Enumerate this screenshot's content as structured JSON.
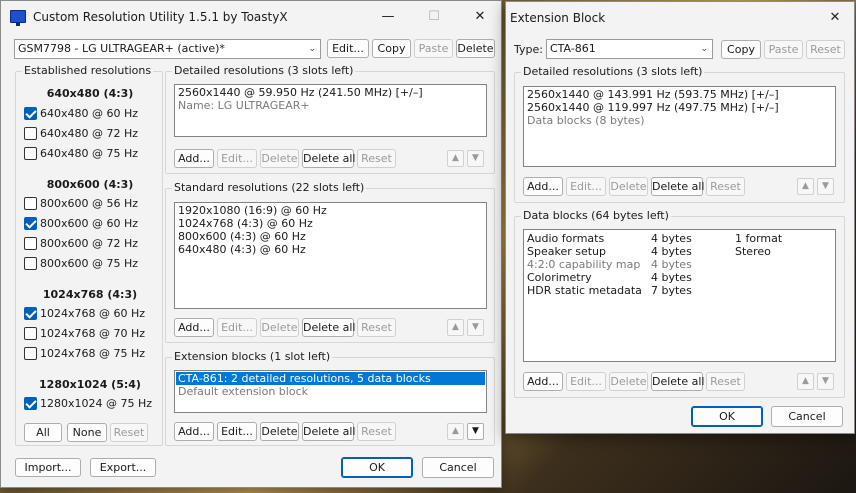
{
  "main_window": {
    "title": "Custom Resolution Utility 1.5.1 by ToastyX",
    "minimize_glyph": "—",
    "maximize_glyph": "☐",
    "close_glyph": "✕",
    "app_icon": "monitor-icon",
    "monitor_select": {
      "value": "GSM7798 - LG ULTRAGEAR+ (active)*"
    },
    "top_buttons": {
      "edit": "Edit...",
      "copy": "Copy",
      "paste": "Paste",
      "delete": "Delete"
    },
    "established": {
      "label": "Established resolutions",
      "groups": [
        {
          "header": "640x480 (4:3)",
          "items": [
            {
              "label": "640x480 @ 60 Hz",
              "checked": true
            },
            {
              "label": "640x480 @ 72 Hz",
              "checked": false
            },
            {
              "label": "640x480 @ 75 Hz",
              "checked": false
            }
          ]
        },
        {
          "header": "800x600 (4:3)",
          "items": [
            {
              "label": "800x600 @ 56 Hz",
              "checked": false
            },
            {
              "label": "800x600 @ 60 Hz",
              "checked": true
            },
            {
              "label": "800x600 @ 72 Hz",
              "checked": false
            },
            {
              "label": "800x600 @ 75 Hz",
              "checked": false
            }
          ]
        },
        {
          "header": "1024x768 (4:3)",
          "items": [
            {
              "label": "1024x768 @ 60 Hz",
              "checked": true
            },
            {
              "label": "1024x768 @ 70 Hz",
              "checked": false
            },
            {
              "label": "1024x768 @ 75 Hz",
              "checked": false
            }
          ]
        },
        {
          "header": "1280x1024 (5:4)",
          "items": [
            {
              "label": "1280x1024 @ 75 Hz",
              "checked": true
            }
          ]
        }
      ],
      "buttons": {
        "all": "All",
        "none": "None",
        "reset": "Reset"
      }
    },
    "detailed": {
      "label": "Detailed resolutions (3 slots left)",
      "rows": [
        "2560x1440 @ 59.950 Hz (241.50 MHz) [+/–]",
        "Name: LG ULTRAGEAR+"
      ],
      "buttons": {
        "add": "Add...",
        "edit": "Edit...",
        "delete": "Delete",
        "delete_all": "Delete all",
        "reset": "Reset"
      }
    },
    "standard": {
      "label": "Standard resolutions (22 slots left)",
      "rows": [
        "1920x1080 (16:9) @ 60 Hz",
        "1024x768 (4:3) @ 60 Hz",
        "800x600 (4:3) @ 60 Hz",
        "640x480 (4:3) @ 60 Hz"
      ],
      "buttons": {
        "add": "Add...",
        "edit": "Edit...",
        "delete": "Delete",
        "delete_all": "Delete all",
        "reset": "Reset"
      }
    },
    "extension": {
      "label": "Extension blocks (1 slot left)",
      "rows": [
        "CTA-861: 2 detailed resolutions, 5 data blocks",
        "Default extension block"
      ],
      "buttons": {
        "add": "Add...",
        "edit": "Edit...",
        "delete": "Delete",
        "delete_all": "Delete all",
        "reset": "Reset"
      }
    },
    "bottom": {
      "import": "Import...",
      "export": "Export...",
      "ok": "OK",
      "cancel": "Cancel"
    },
    "arrows": {
      "up": "▲",
      "down": "▼"
    }
  },
  "ext_window": {
    "title": "Extension Block",
    "close_glyph": "✕",
    "type_label": "Type:",
    "type_value": "CTA-861",
    "top_buttons": {
      "copy": "Copy",
      "paste": "Paste",
      "reset": "Reset"
    },
    "detailed": {
      "label": "Detailed resolutions (3 slots left)",
      "rows": [
        "2560x1440 @ 143.991 Hz (593.75 MHz) [+/–]",
        "2560x1440 @ 119.997 Hz (497.75 MHz) [+/–]",
        "Data blocks (8 bytes)"
      ],
      "buttons": {
        "add": "Add...",
        "edit": "Edit...",
        "delete": "Delete",
        "delete_all": "Delete all",
        "reset": "Reset"
      }
    },
    "data_blocks": {
      "label": "Data blocks (64 bytes left)",
      "rows": [
        {
          "name": "Audio formats",
          "size": "4 bytes",
          "info": "1 format"
        },
        {
          "name": "Speaker setup",
          "size": "4 bytes",
          "info": "Stereo"
        },
        {
          "name": "4:2:0 capability map",
          "size": "4 bytes",
          "info": ""
        },
        {
          "name": "Colorimetry",
          "size": "4 bytes",
          "info": ""
        },
        {
          "name": "HDR static metadata",
          "size": "7 bytes",
          "info": ""
        }
      ],
      "buttons": {
        "add": "Add...",
        "edit": "Edit...",
        "delete": "Delete",
        "delete_all": "Delete all",
        "reset": "Reset"
      }
    },
    "bottom": {
      "ok": "OK",
      "cancel": "Cancel"
    }
  }
}
